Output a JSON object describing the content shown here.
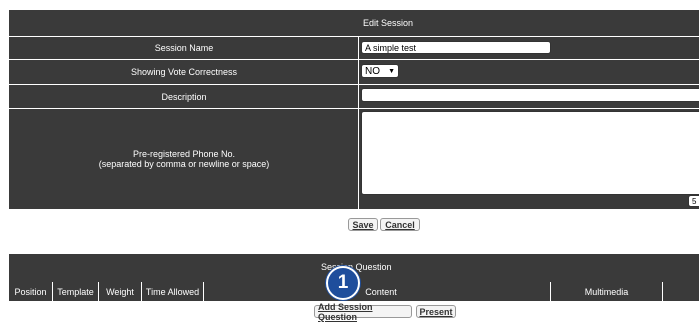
{
  "edit_session": {
    "title": "Edit Session",
    "session_name_label": "Session Name",
    "session_name_value": "A simple test",
    "vote_label": "Showing Vote Correctness",
    "vote_value": "NO",
    "description_label": "Description",
    "description_value": "",
    "phone_label_line1": "Pre-registered Phone No.",
    "phone_label_line2": "(separated by comma or newline or space)",
    "phone_value": "",
    "phone_counter": "5",
    "save_label": "Save",
    "cancel_label": "Cancel"
  },
  "session_question": {
    "title": "Session Question",
    "columns": [
      "Position",
      "Template",
      "Weight",
      "Time Allowed",
      "Content",
      "Multimedia"
    ],
    "add_label": "Add Session Question",
    "present_label": "Present"
  },
  "callout": {
    "number": "1"
  },
  "colors": {
    "header_bg": "#3a3a3a",
    "badge": "#1f4e9c"
  }
}
